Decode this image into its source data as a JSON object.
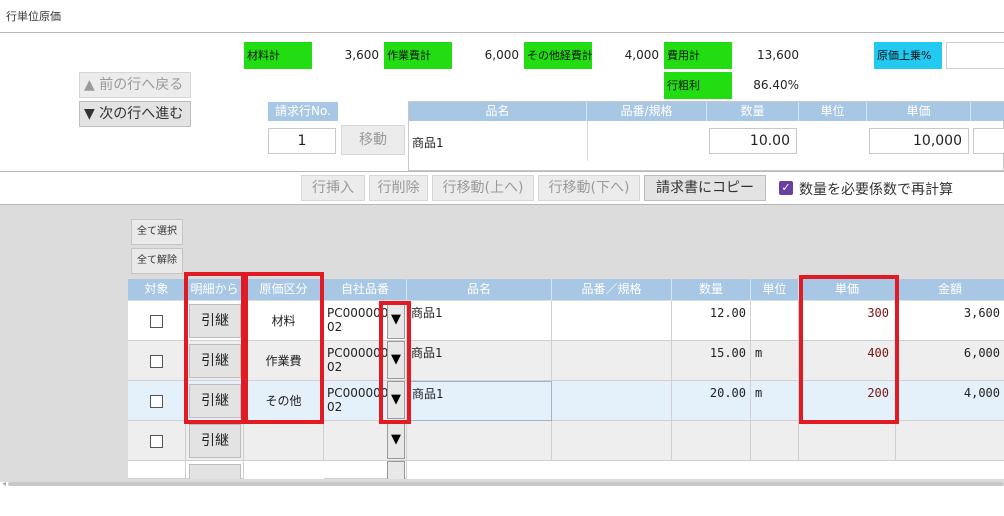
{
  "page_title": "行単位原価",
  "summary": {
    "material_label": "材料計",
    "material_value": "3,600",
    "labor_label": "作業費計",
    "labor_value": "6,000",
    "other_label": "その他経費計",
    "other_value": "4,000",
    "cost_label": "費用計",
    "cost_value": "13,600",
    "markup_label": "原価上乗%",
    "gross_label": "行粗利",
    "gross_value": "86.40%"
  },
  "nav": {
    "prev_label": "▲ 前の行へ戻る",
    "next_label": "▼ 次の行へ進む"
  },
  "line_header": {
    "billing_row_label": "請求行No.",
    "billing_row_value": "1",
    "move_label": "移動",
    "columns": [
      "品名",
      "品番/規格",
      "数量",
      "単位",
      "単価"
    ],
    "item_name": "商品1",
    "quantity": "10.00",
    "unit_price": "10,000"
  },
  "toolbar": {
    "insert": "行挿入",
    "delete": "行削除",
    "move_up": "行移動(上へ)",
    "move_down": "行移動(下へ)",
    "copy": "請求書にコピー",
    "recalc_checked": true,
    "recalc_label": "数量を必要係数で再計算"
  },
  "grid": {
    "select_all": "全て選択",
    "deselect_all": "全て解除",
    "columns": [
      "対象",
      "明細から",
      "原価区分",
      "自社品番",
      "品名",
      "品番／規格",
      "数量",
      "単位",
      "単価",
      "金額"
    ],
    "button_label": "引継",
    "dropdown_icon": "▼",
    "rows": [
      {
        "category": "材料",
        "code_l1": "PC000000",
        "code_l2": "02",
        "name": "商品1",
        "qty": "12.00",
        "unit": "",
        "price": "300",
        "amount": "3,600"
      },
      {
        "category": "作業費",
        "code_l1": "PC000000",
        "code_l2": "02",
        "name": "商品1",
        "qty": "15.00",
        "unit": "m",
        "price": "400",
        "amount": "6,000"
      },
      {
        "category": "その他",
        "code_l1": "PC000000",
        "code_l2": "02",
        "name": "商品1",
        "qty": "20.00",
        "unit": "m",
        "price": "200",
        "amount": "4,000"
      },
      {
        "category": "",
        "code_l1": "",
        "code_l2": "",
        "name": "",
        "qty": "",
        "unit": "",
        "price": "",
        "amount": ""
      }
    ]
  },
  "colors": {
    "summary_green": "#22dd11",
    "markup_cyan": "#22c9f0",
    "header_blue": "#a8c7e4",
    "highlight_red": "#e01b24",
    "selected_row": "#e4f0fa"
  }
}
